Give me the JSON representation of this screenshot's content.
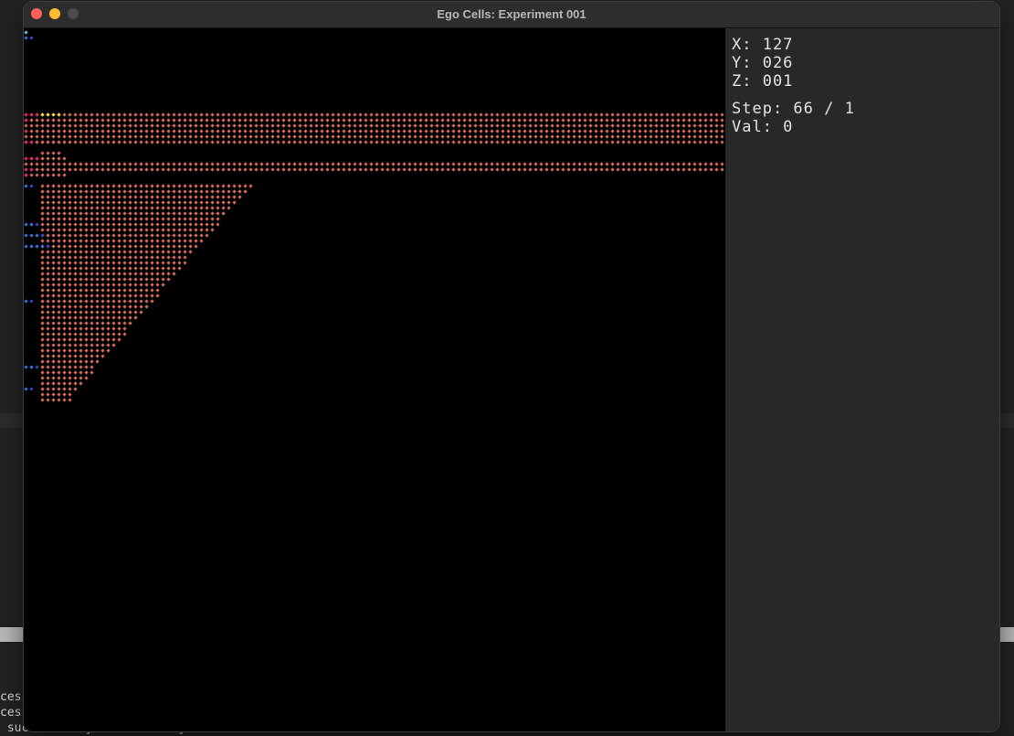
{
  "window": {
    "title": "Ego Cells: Experiment 001"
  },
  "readouts": {
    "x": "X: 127",
    "y": "Y: 026",
    "z": "Z: 001",
    "step": "Step: 66 / 1",
    "val": "Val: 0"
  },
  "background_terminal": {
    "lines": [
      "cess",
      "cess",
      " successfully to Sub-fully"
    ]
  },
  "colors": {
    "cell_orange": "#d2685a",
    "cell_magenta": "#d8286a",
    "cell_yellow": "#f4e23a",
    "cell_blue": "#3f6fd8",
    "cell_cyan": "#58c8e6",
    "cell_navy": "#3446c0",
    "panel_bg": "#282828",
    "canvas_bg": "#000000"
  },
  "icons": [
    "close-icon",
    "minimize-icon",
    "maximize-icon"
  ]
}
